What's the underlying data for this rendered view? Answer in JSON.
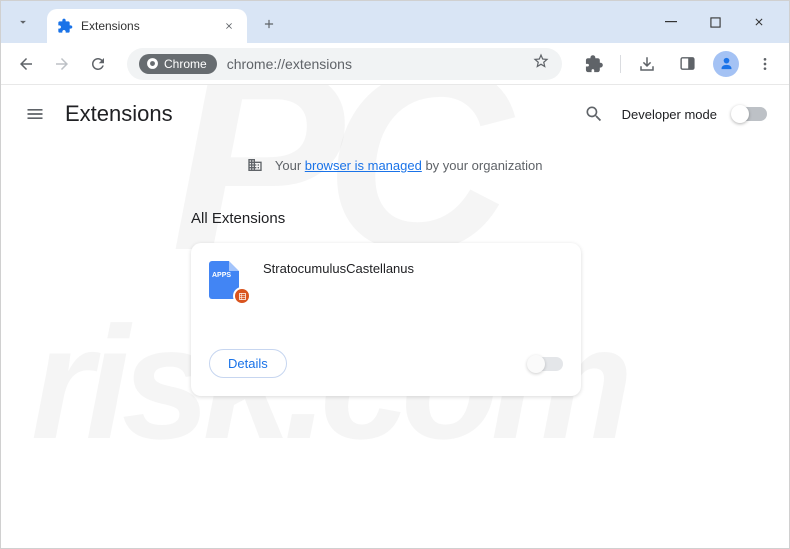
{
  "tab": {
    "title": "Extensions"
  },
  "addressBar": {
    "chipLabel": "Chrome",
    "url": "chrome://extensions"
  },
  "pageHeader": {
    "title": "Extensions",
    "devModeLabel": "Developer mode"
  },
  "managedBanner": {
    "prefix": "Your ",
    "link": "browser is managed",
    "suffix": " by your organization"
  },
  "content": {
    "sectionTitle": "All Extensions",
    "extension": {
      "name": "StratocumulusCastellanus",
      "detailsLabel": "Details"
    }
  }
}
